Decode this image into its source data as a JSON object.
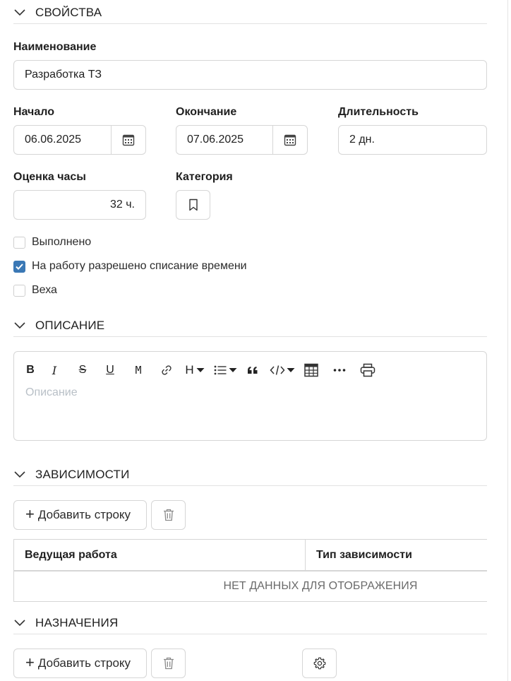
{
  "sections": {
    "properties": "СВОЙСТВА",
    "description": "ОПИСАНИЕ",
    "dependencies": "ЗАВИСИМОСТИ",
    "assignments": "НАЗНАЧЕНИЯ"
  },
  "fields": {
    "name_label": "Наименование",
    "name_value": "Разработка ТЗ",
    "start_label": "Начало",
    "start_value": "06.06.2025",
    "end_label": "Окончание",
    "end_value": "07.06.2025",
    "duration_label": "Длительность",
    "duration_value": "2 дн.",
    "estimate_label": "Оценка часы",
    "estimate_value": "32 ч.",
    "category_label": "Категория"
  },
  "checkboxes": [
    {
      "label": "Выполнено",
      "checked": false
    },
    {
      "label": "На работу разрешено списание времени",
      "checked": true
    },
    {
      "label": "Веха",
      "checked": false
    }
  ],
  "editor": {
    "placeholder": "Описание",
    "toolbar": [
      "bold",
      "italic",
      "strikethrough",
      "underline",
      "monospace",
      "link",
      "heading",
      "list",
      "quote",
      "code",
      "table",
      "more",
      "print"
    ],
    "bold_glyph": "B",
    "italic_glyph": "I",
    "strike_glyph": "S",
    "underline_glyph": "U",
    "mono_glyph": "M",
    "heading_glyph": "H"
  },
  "dependencies": {
    "add_label": "Добавить строку",
    "columns": [
      "Ведущая работа",
      "Тип зависимости"
    ],
    "empty_text": "НЕТ ДАННЫХ ДЛЯ ОТОБРАЖЕНИЯ"
  },
  "assignments": {
    "add_label": "Добавить строку"
  },
  "colors": {
    "accent": "#3a78b5",
    "border": "#d6d6d6",
    "placeholder": "#b9c0c7"
  }
}
